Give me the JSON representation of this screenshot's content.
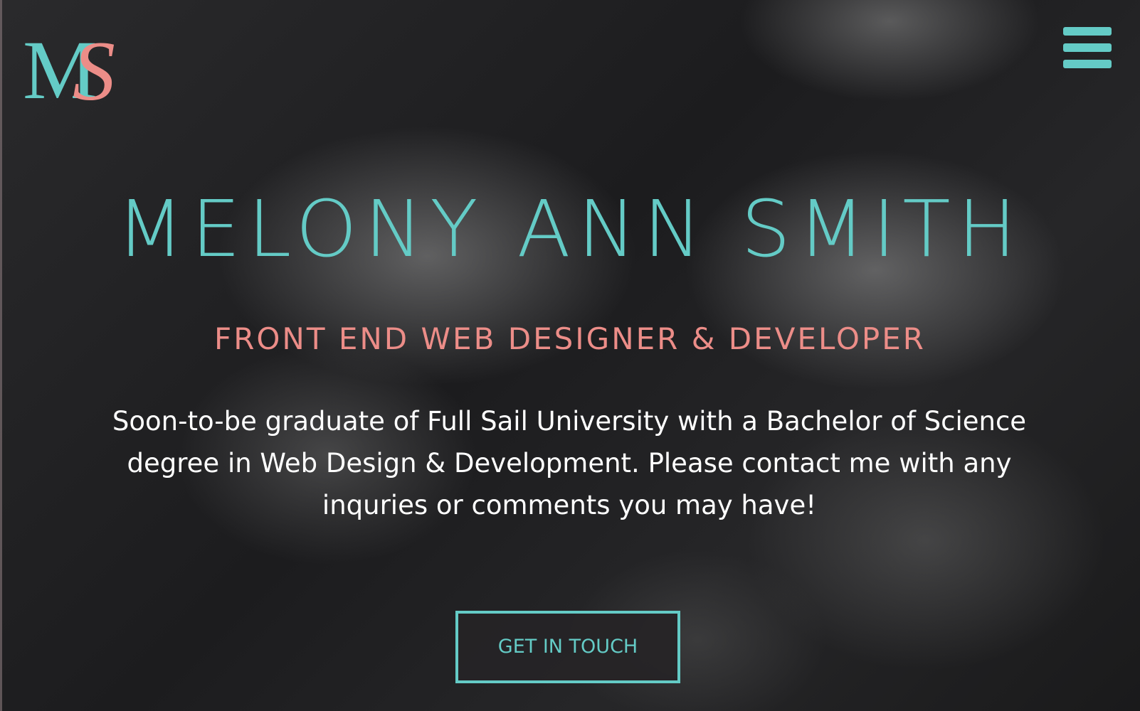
{
  "logo": {
    "letter_m": "M",
    "letter_s": "S",
    "m_color": "#64cbc6",
    "s_color": "#ec8d88"
  },
  "menu": {
    "icon": "hamburger-menu-icon"
  },
  "hero": {
    "title": "MELONY ANN SMITH",
    "subtitle": "FRONT END WEB DESIGNER & DEVELOPER",
    "description": "Soon-to-be graduate of Full Sail University with a Bachelor of Science degree in Web Design & Development. Please contact me with any inquries or comments you may have!",
    "cta_label": "GET IN TOUCH"
  },
  "colors": {
    "accent": "#64cbc6",
    "secondary": "#ec8d88",
    "text": "#ffffff"
  }
}
